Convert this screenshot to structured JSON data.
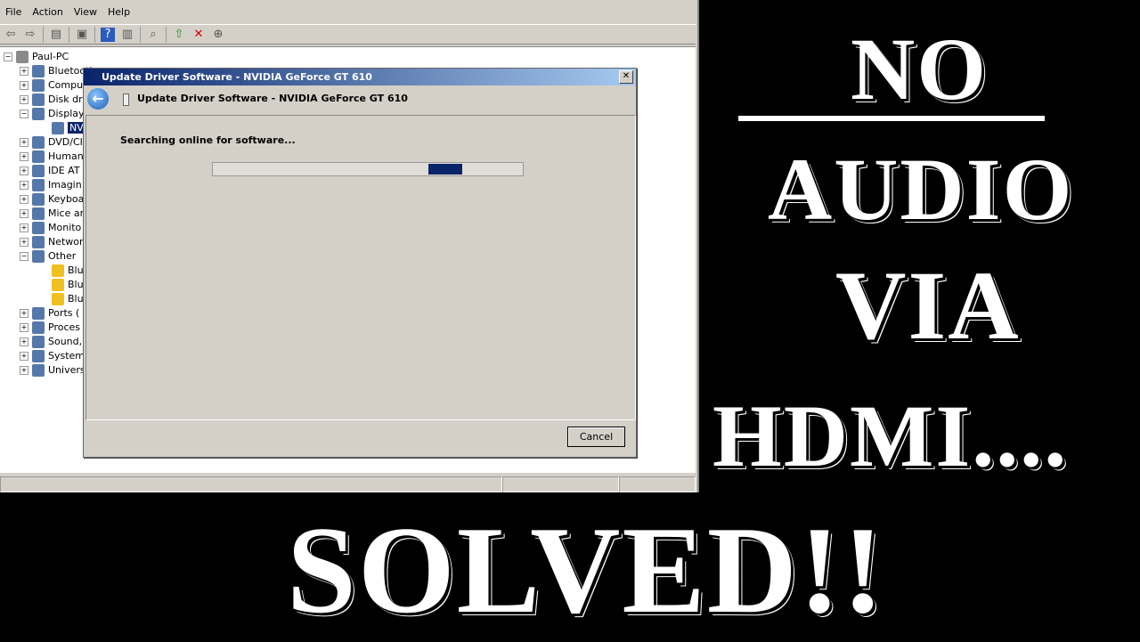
{
  "menu": [
    "File",
    "Action",
    "View",
    "Help"
  ],
  "tree": {
    "root": "Paul-PC",
    "items": [
      {
        "label": "Bluetooth",
        "box": "+"
      },
      {
        "label": "Compu",
        "box": "+"
      },
      {
        "label": "Disk dr",
        "box": "+"
      },
      {
        "label": "Display",
        "box": "−"
      },
      {
        "label": "NV",
        "box": "",
        "child": true,
        "selected": true
      },
      {
        "label": "DVD/CI",
        "box": "+"
      },
      {
        "label": "Human",
        "box": "+"
      },
      {
        "label": "IDE AT",
        "box": "+"
      },
      {
        "label": "Imagin",
        "box": "+"
      },
      {
        "label": "Keyboa",
        "box": "+"
      },
      {
        "label": "Mice ar",
        "box": "+"
      },
      {
        "label": "Monito",
        "box": "+"
      },
      {
        "label": "Networ",
        "box": "+"
      },
      {
        "label": "Other",
        "box": "−"
      },
      {
        "label": "Blu",
        "box": "",
        "child": true,
        "warn": true
      },
      {
        "label": "Blu",
        "box": "",
        "child": true,
        "warn": true
      },
      {
        "label": "Blu",
        "box": "",
        "child": true,
        "warn": true
      },
      {
        "label": "Ports (",
        "box": "+"
      },
      {
        "label": "Proces",
        "box": "+"
      },
      {
        "label": "Sound,",
        "box": "+"
      },
      {
        "label": "System",
        "box": "+"
      },
      {
        "label": "Univers",
        "box": "+"
      }
    ]
  },
  "dialog": {
    "title": "Update Driver Software - NVIDIA GeForce GT 610",
    "header": "Update Driver Software - NVIDIA GeForce GT 610",
    "status": "Searching online for software...",
    "cancel": "Cancel",
    "close": "✕"
  },
  "overlay": {
    "line1": "NO",
    "line2": "AUDIO",
    "line3": "VIA",
    "line4": "HDMI....",
    "line5": "SOLVED!!"
  },
  "colors": {
    "titlebar": "#0a246a",
    "progress": "#0a246a"
  }
}
